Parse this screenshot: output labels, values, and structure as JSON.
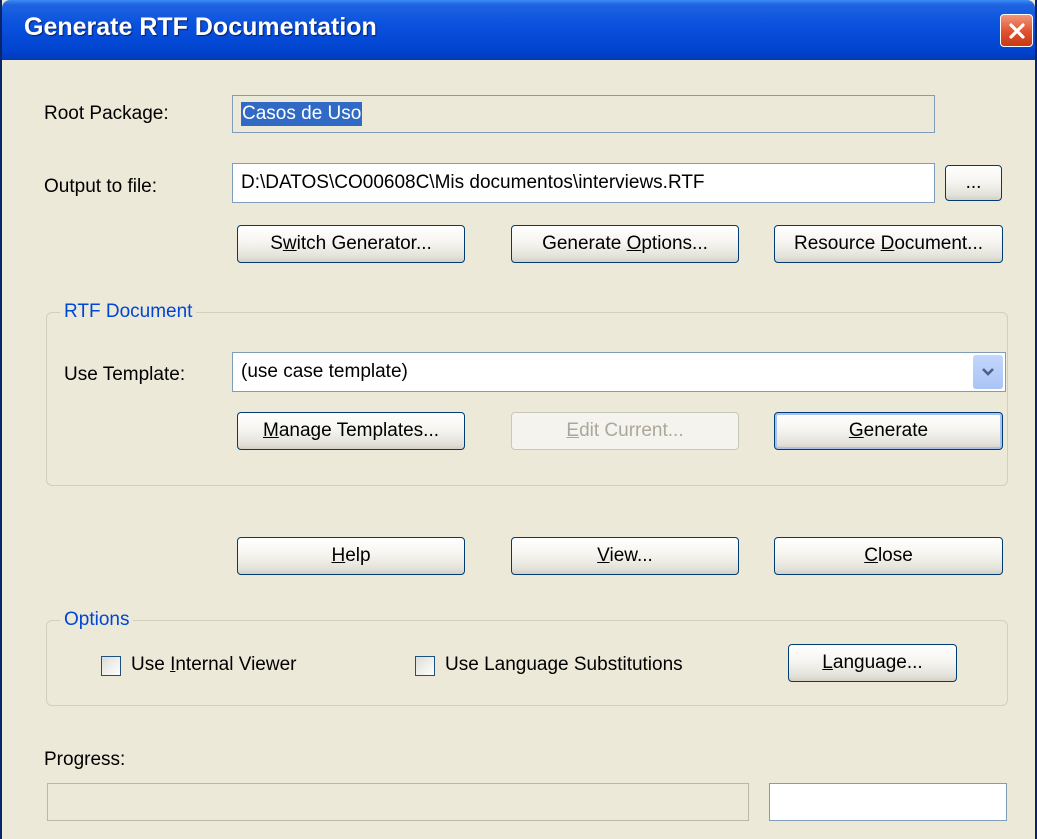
{
  "window": {
    "title": "Generate RTF Documentation"
  },
  "root_package": {
    "label": "Root Package:",
    "value": "Casos de Uso"
  },
  "output": {
    "label": "Output to file:",
    "value": "D:\\DATOS\\CO00608C\\Mis documentos\\interviews.RTF",
    "browse_label": "..."
  },
  "top_buttons": {
    "switch_generator": {
      "before": "S",
      "accel": "w",
      "after": "itch Generator..."
    },
    "generate_options": {
      "before": "Generate ",
      "accel": "O",
      "after": "ptions..."
    },
    "resource_document": {
      "before": "Resource ",
      "accel": "D",
      "after": "ocument..."
    }
  },
  "rtf_group": {
    "legend": "RTF Document",
    "template_label": "Use Template:",
    "template_value": "(use case template)",
    "manage_templates": {
      "before": "",
      "accel": "M",
      "after": "anage Templates..."
    },
    "edit_current": {
      "before": "",
      "accel": "E",
      "after": "dit Current..."
    },
    "generate": {
      "before": "",
      "accel": "G",
      "after": "enerate"
    }
  },
  "action_buttons": {
    "help": {
      "before": "",
      "accel": "H",
      "after": "elp"
    },
    "view": {
      "before": "",
      "accel": "V",
      "after": "iew..."
    },
    "close": {
      "before": "",
      "accel": "C",
      "after": "lose"
    }
  },
  "options_group": {
    "legend": "Options",
    "internal_viewer": {
      "before": "Use ",
      "accel": "I",
      "after": "nternal Viewer",
      "checked": false
    },
    "language_substitutions": {
      "label": "Use Language Substitutions",
      "checked": false
    },
    "language_button": {
      "before": "",
      "accel": "L",
      "after": "anguage..."
    }
  },
  "progress": {
    "label": "Progress:",
    "value": 0
  },
  "colors": {
    "titlebar": "#0a52de",
    "dialog_bg": "#ece9d8",
    "group_legend": "#0046d5",
    "selection": "#316ac5",
    "close_button": "#e0512f"
  }
}
